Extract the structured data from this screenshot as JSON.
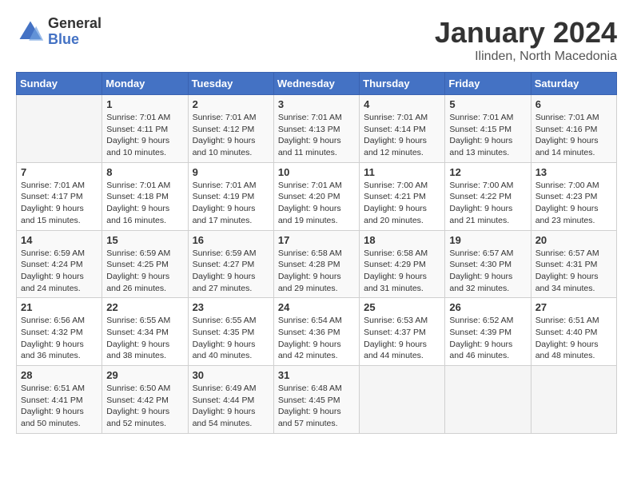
{
  "header": {
    "logo_general": "General",
    "logo_blue": "Blue",
    "month_title": "January 2024",
    "location": "Ilinden, North Macedonia"
  },
  "days_of_week": [
    "Sunday",
    "Monday",
    "Tuesday",
    "Wednesday",
    "Thursday",
    "Friday",
    "Saturday"
  ],
  "weeks": [
    [
      {
        "day": "",
        "info": ""
      },
      {
        "day": "1",
        "info": "Sunrise: 7:01 AM\nSunset: 4:11 PM\nDaylight: 9 hours\nand 10 minutes."
      },
      {
        "day": "2",
        "info": "Sunrise: 7:01 AM\nSunset: 4:12 PM\nDaylight: 9 hours\nand 10 minutes."
      },
      {
        "day": "3",
        "info": "Sunrise: 7:01 AM\nSunset: 4:13 PM\nDaylight: 9 hours\nand 11 minutes."
      },
      {
        "day": "4",
        "info": "Sunrise: 7:01 AM\nSunset: 4:14 PM\nDaylight: 9 hours\nand 12 minutes."
      },
      {
        "day": "5",
        "info": "Sunrise: 7:01 AM\nSunset: 4:15 PM\nDaylight: 9 hours\nand 13 minutes."
      },
      {
        "day": "6",
        "info": "Sunrise: 7:01 AM\nSunset: 4:16 PM\nDaylight: 9 hours\nand 14 minutes."
      }
    ],
    [
      {
        "day": "7",
        "info": "Sunrise: 7:01 AM\nSunset: 4:17 PM\nDaylight: 9 hours\nand 15 minutes."
      },
      {
        "day": "8",
        "info": "Sunrise: 7:01 AM\nSunset: 4:18 PM\nDaylight: 9 hours\nand 16 minutes."
      },
      {
        "day": "9",
        "info": "Sunrise: 7:01 AM\nSunset: 4:19 PM\nDaylight: 9 hours\nand 17 minutes."
      },
      {
        "day": "10",
        "info": "Sunrise: 7:01 AM\nSunset: 4:20 PM\nDaylight: 9 hours\nand 19 minutes."
      },
      {
        "day": "11",
        "info": "Sunrise: 7:00 AM\nSunset: 4:21 PM\nDaylight: 9 hours\nand 20 minutes."
      },
      {
        "day": "12",
        "info": "Sunrise: 7:00 AM\nSunset: 4:22 PM\nDaylight: 9 hours\nand 21 minutes."
      },
      {
        "day": "13",
        "info": "Sunrise: 7:00 AM\nSunset: 4:23 PM\nDaylight: 9 hours\nand 23 minutes."
      }
    ],
    [
      {
        "day": "14",
        "info": "Sunrise: 6:59 AM\nSunset: 4:24 PM\nDaylight: 9 hours\nand 24 minutes."
      },
      {
        "day": "15",
        "info": "Sunrise: 6:59 AM\nSunset: 4:25 PM\nDaylight: 9 hours\nand 26 minutes."
      },
      {
        "day": "16",
        "info": "Sunrise: 6:59 AM\nSunset: 4:27 PM\nDaylight: 9 hours\nand 27 minutes."
      },
      {
        "day": "17",
        "info": "Sunrise: 6:58 AM\nSunset: 4:28 PM\nDaylight: 9 hours\nand 29 minutes."
      },
      {
        "day": "18",
        "info": "Sunrise: 6:58 AM\nSunset: 4:29 PM\nDaylight: 9 hours\nand 31 minutes."
      },
      {
        "day": "19",
        "info": "Sunrise: 6:57 AM\nSunset: 4:30 PM\nDaylight: 9 hours\nand 32 minutes."
      },
      {
        "day": "20",
        "info": "Sunrise: 6:57 AM\nSunset: 4:31 PM\nDaylight: 9 hours\nand 34 minutes."
      }
    ],
    [
      {
        "day": "21",
        "info": "Sunrise: 6:56 AM\nSunset: 4:32 PM\nDaylight: 9 hours\nand 36 minutes."
      },
      {
        "day": "22",
        "info": "Sunrise: 6:55 AM\nSunset: 4:34 PM\nDaylight: 9 hours\nand 38 minutes."
      },
      {
        "day": "23",
        "info": "Sunrise: 6:55 AM\nSunset: 4:35 PM\nDaylight: 9 hours\nand 40 minutes."
      },
      {
        "day": "24",
        "info": "Sunrise: 6:54 AM\nSunset: 4:36 PM\nDaylight: 9 hours\nand 42 minutes."
      },
      {
        "day": "25",
        "info": "Sunrise: 6:53 AM\nSunset: 4:37 PM\nDaylight: 9 hours\nand 44 minutes."
      },
      {
        "day": "26",
        "info": "Sunrise: 6:52 AM\nSunset: 4:39 PM\nDaylight: 9 hours\nand 46 minutes."
      },
      {
        "day": "27",
        "info": "Sunrise: 6:51 AM\nSunset: 4:40 PM\nDaylight: 9 hours\nand 48 minutes."
      }
    ],
    [
      {
        "day": "28",
        "info": "Sunrise: 6:51 AM\nSunset: 4:41 PM\nDaylight: 9 hours\nand 50 minutes."
      },
      {
        "day": "29",
        "info": "Sunrise: 6:50 AM\nSunset: 4:42 PM\nDaylight: 9 hours\nand 52 minutes."
      },
      {
        "day": "30",
        "info": "Sunrise: 6:49 AM\nSunset: 4:44 PM\nDaylight: 9 hours\nand 54 minutes."
      },
      {
        "day": "31",
        "info": "Sunrise: 6:48 AM\nSunset: 4:45 PM\nDaylight: 9 hours\nand 57 minutes."
      },
      {
        "day": "",
        "info": ""
      },
      {
        "day": "",
        "info": ""
      },
      {
        "day": "",
        "info": ""
      }
    ]
  ]
}
